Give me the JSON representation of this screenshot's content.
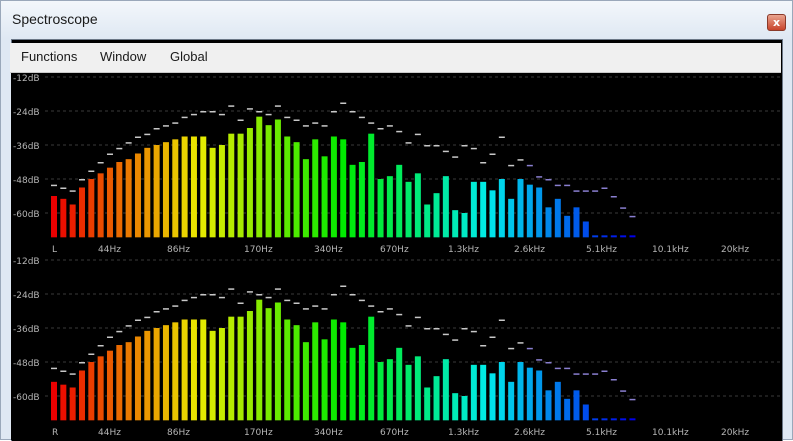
{
  "window": {
    "title": "Spectroscope",
    "close_icon": "close-icon",
    "close_glyph": "x"
  },
  "menu": {
    "items": [
      "Functions",
      "Window",
      "Global"
    ]
  },
  "colors": {
    "background": "#000000",
    "gridline": "#3a3a3a",
    "label": "#b5b5b5",
    "peak_marker": "#c8c8c8"
  },
  "channels": [
    {
      "name": "L",
      "db_labels": [
        "-12dB",
        "-24dB",
        "-36dB",
        "-48dB",
        "-60dB"
      ]
    },
    {
      "name": "R",
      "db_labels": [
        "-12dB",
        "-24dB",
        "-36dB",
        "-48dB",
        "-60dB"
      ]
    }
  ],
  "chart_data": {
    "type": "bar",
    "db_ticks": [
      -12,
      -24,
      -36,
      -48,
      -60
    ],
    "ylim": [
      -70,
      -12
    ],
    "freq_labels": [
      "44Hz",
      "86Hz",
      "170Hz",
      "340Hz",
      "670Hz",
      "1.3kHz",
      "2.6kHz",
      "5.1kHz",
      "10.1kHz",
      "20kHz"
    ],
    "grid": true,
    "series": [
      {
        "name": "L",
        "levels_db": [
          -54,
          -55,
          -57,
          -51,
          -48,
          -46,
          -44,
          -42,
          -41,
          -39,
          -37,
          -36,
          -35,
          -34,
          -33,
          -33,
          -33,
          -37,
          -36,
          -32,
          -32,
          -30,
          -26,
          -29,
          -27,
          -33,
          -35,
          -41,
          -34,
          -40,
          -33,
          -34,
          -43,
          -42,
          -32,
          -48,
          -47,
          -43,
          -49,
          -46,
          -57,
          -53,
          -47,
          -59,
          -60,
          -49,
          -49,
          -52,
          -48,
          -55,
          -48,
          -50,
          -51,
          -58,
          -55,
          -61,
          -58,
          -63,
          -70,
          -72,
          -73,
          -74,
          -76
        ],
        "peaks_db": [
          -50,
          -51,
          -52,
          -48,
          -45,
          -42,
          -39,
          -37,
          -35,
          -33,
          -32,
          -30,
          -29,
          -28,
          -26,
          -25,
          -24,
          -24,
          -25,
          -22,
          -27,
          -23,
          -24,
          -25,
          -22,
          -26,
          -27,
          -29,
          -28,
          -29,
          -24,
          -21,
          -24,
          -26,
          -28,
          -30,
          -29,
          -31,
          -35,
          -32,
          -36,
          -36,
          -38,
          -40,
          -36,
          -37,
          -42,
          -39,
          -33,
          -43,
          -41,
          -43,
          -47,
          -48,
          -50,
          -50,
          -52,
          -52,
          -52,
          -51,
          -54,
          -58,
          -61
        ]
      },
      {
        "name": "R",
        "levels_db": [
          -55,
          -56,
          -57,
          -51,
          -48,
          -46,
          -44,
          -42,
          -41,
          -39,
          -37,
          -36,
          -35,
          -34,
          -33,
          -33,
          -33,
          -37,
          -36,
          -32,
          -32,
          -30,
          -26,
          -29,
          -27,
          -33,
          -35,
          -41,
          -34,
          -40,
          -33,
          -34,
          -43,
          -42,
          -32,
          -48,
          -47,
          -43,
          -49,
          -46,
          -57,
          -53,
          -47,
          -59,
          -60,
          -49,
          -49,
          -52,
          -48,
          -55,
          -48,
          -50,
          -51,
          -58,
          -55,
          -61,
          -58,
          -63,
          -70,
          -72,
          -73,
          -74,
          -76
        ],
        "peaks_db": [
          -50,
          -51,
          -52,
          -48,
          -45,
          -42,
          -39,
          -37,
          -35,
          -33,
          -32,
          -30,
          -29,
          -28,
          -26,
          -25,
          -24,
          -24,
          -25,
          -22,
          -27,
          -23,
          -24,
          -25,
          -22,
          -26,
          -27,
          -29,
          -28,
          -29,
          -24,
          -21,
          -24,
          -26,
          -28,
          -30,
          -29,
          -31,
          -35,
          -32,
          -36,
          -36,
          -38,
          -40,
          -36,
          -37,
          -42,
          -39,
          -33,
          -43,
          -41,
          -43,
          -47,
          -48,
          -50,
          -50,
          -52,
          -52,
          -52,
          -51,
          -54,
          -58,
          -61
        ]
      }
    ]
  }
}
